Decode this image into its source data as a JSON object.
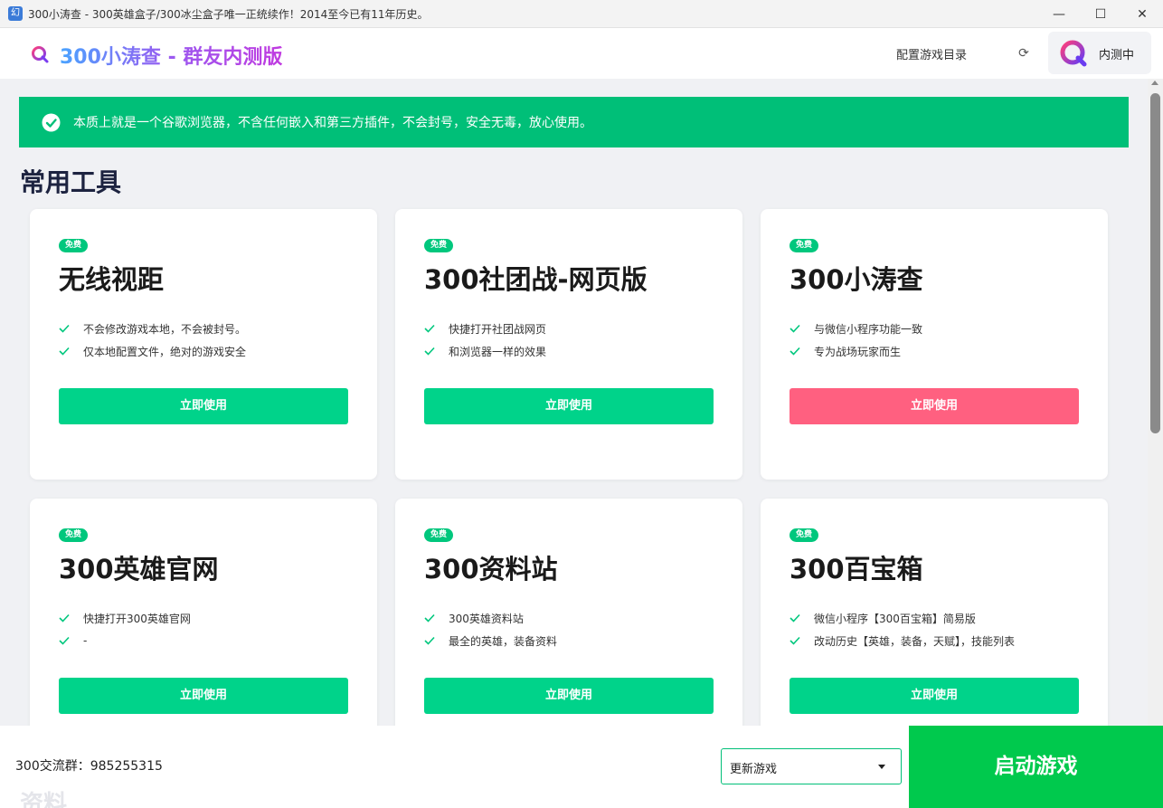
{
  "window": {
    "title": "300小涛查 - 300英雄盒子/300冰尘盒子唯一正统续作！2014至今已有11年历史。",
    "app_icon_glyph": "幻",
    "minimize_glyph": "—",
    "maximize_glyph": "☐",
    "close_glyph": "✕"
  },
  "header": {
    "brand": "300小涛查 - 群友内测版",
    "config_link": "配置游戏目录",
    "refresh_glyph": "⟳",
    "beta_label": "内测中"
  },
  "notice": {
    "text": "本质上就是一个谷歌浏览器，不含任何嵌入和第三方插件，不会封号，安全无毒，放心使用。"
  },
  "section": {
    "title": "常用工具",
    "next_title": "资料"
  },
  "cards": [
    {
      "badge": "免费",
      "title": "无线视距",
      "features": [
        "不会修改游戏本地，不会被封号。",
        "仅本地配置文件，绝对的游戏安全"
      ],
      "button": "立即使用"
    },
    {
      "badge": "免费",
      "title": "300社团战-网页版",
      "features": [
        "快捷打开社团战网页",
        "和浏览器一样的效果"
      ],
      "button": "立即使用"
    },
    {
      "badge": "免费",
      "title": "300小涛查",
      "features": [
        "与微信小程序功能一致",
        "专为战场玩家而生"
      ],
      "button": "立即使用"
    },
    {
      "badge": "免费",
      "title": "300英雄官网",
      "features": [
        "快捷打开300英雄官网",
        "-"
      ],
      "button": "立即使用"
    },
    {
      "badge": "免费",
      "title": "300资料站",
      "features": [
        "300英雄资料站",
        "最全的英雄，装备资料"
      ],
      "button": "立即使用"
    },
    {
      "badge": "免费",
      "title": "300百宝箱",
      "features": [
        "微信小程序【300百宝箱】简易版",
        "改动历史【英雄，装备，天赋】，技能列表"
      ],
      "button": "立即使用"
    }
  ],
  "bottom": {
    "group_text": "300交流群：985255315",
    "select_value": "更新游戏",
    "launch_button": "启动游戏"
  },
  "colors": {
    "accent_green": "#00bf78",
    "button_green": "#00d38a",
    "button_pink": "#ff6080",
    "launch_green": "#00c94d"
  }
}
